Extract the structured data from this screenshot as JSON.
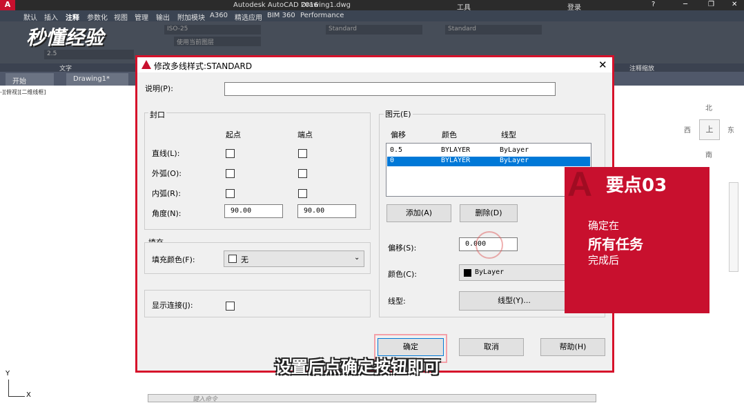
{
  "app": {
    "title": "Autodesk AutoCAD 2016",
    "file": "Drawing1.dwg",
    "search_label": "工具",
    "login": "登录"
  },
  "menu": [
    "默认",
    "插入",
    "注释",
    "参数化",
    "视图",
    "管理",
    "输出",
    "附加模块",
    "A360",
    "精选应用",
    "BIM 360",
    "Performance"
  ],
  "ribbon": {
    "text_panel": "文字",
    "annotate_scale": "注释缩放",
    "text_height": "2.5",
    "style1": "ISO-25",
    "style2": "Standard",
    "style3": "Standard",
    "use_current": "使用当前图层"
  },
  "doc_tabs": [
    "开始",
    "Drawing1*"
  ],
  "viewport_label": "-][俯视][二维线框]",
  "watermark": "秒懂经验",
  "dialog": {
    "title": "修改多线样式:STANDARD",
    "description_label": "说明(P):",
    "description_value": "",
    "caps": {
      "title": "封口",
      "start_col": "起点",
      "end_col": "端点",
      "rows": [
        {
          "label": "直线(L):"
        },
        {
          "label": "外弧(O):"
        },
        {
          "label": "内弧(R):"
        },
        {
          "label": "角度(N):"
        }
      ],
      "angle_start": "90.00",
      "angle_end": "90.00"
    },
    "fill": {
      "title": "填充",
      "color_label": "填充颜色(F):",
      "color_value": "无"
    },
    "show_joints_label": "显示连接(J):",
    "elements": {
      "title": "图元(E)",
      "headers": [
        "偏移",
        "颜色",
        "线型"
      ],
      "rows": [
        [
          "0.5",
          "BYLAYER",
          "ByLayer"
        ],
        [
          "0",
          "BYLAYER",
          "ByLayer"
        ]
      ],
      "add_button": "添加(A)",
      "delete_button": "删除(D)",
      "offset_label": "偏移(S):",
      "offset_value": "0.000",
      "color_label": "颜色(C):",
      "color_value": "ByLayer",
      "linetype_label": "线型:",
      "linetype_button": "线型(Y)..."
    },
    "ok_button": "确定",
    "cancel_button": "取消",
    "help_button": "帮助(H)"
  },
  "compass": {
    "north": "北",
    "west": "西",
    "east": "东",
    "south": "南",
    "top": "上"
  },
  "overlay": {
    "heading": "要点03",
    "line1": "确定在",
    "line2": "所有任务",
    "line3": "完成后"
  },
  "subtitle": "设置后点确定按钮即可",
  "command_placeholder": "键入命令",
  "ucs": {
    "y": "Y",
    "x": "X"
  },
  "colors": {
    "accent_red": "#d6112a",
    "selection_blue": "#0078d7",
    "card_red": "#c8102e"
  }
}
